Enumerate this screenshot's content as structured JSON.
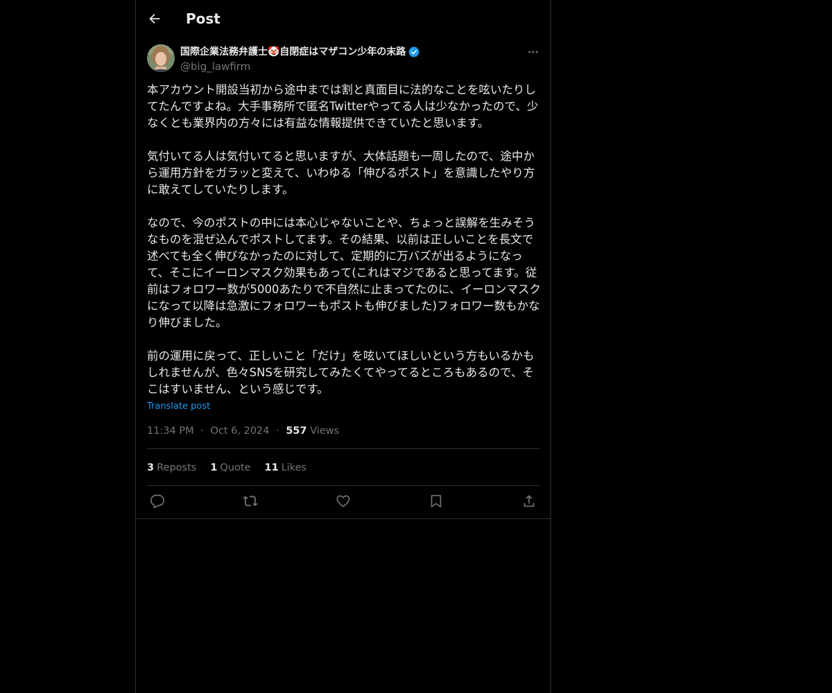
{
  "header": {
    "title": "Post",
    "back_icon": "arrow-left-icon"
  },
  "author": {
    "display_name": "国際企業法務弁護士🤡自閉症はマザコン少年の末路",
    "handle": "@big_lawfirm",
    "verified": true,
    "verified_color": "#1d9bf0",
    "avatar_icon": "user-avatar"
  },
  "post": {
    "text": "本アカウント開設当初から途中までは割と真面目に法的なことを呟いたりしてたんですよね。大手事務所で匿名Twitterやってる人は少なかったので、少なくとも業界内の方々には有益な情報提供できていたと思います。\n\n気付いてる人は気付いてると思いますが、大体話題も一周したので、途中から運用方針をガラッと変えて、いわゆる「伸びるポスト」を意識したやり方に敢えてしていたりします。\n\nなので、今のポストの中には本心じゃないことや、ちょっと誤解を生みそうなものを混ぜ込んでポストしてます。その結果、以前は正しいことを長文で述べても全く伸びなかったのに対して、定期的に万バズが出るようになって、そこにイーロンマスク効果もあって(これはマジであると思ってます。従前はフォロワー数が5000あたりで不自然に止まってたのに、イーロンマスクになって以降は急激にフォロワーもポストも伸びました)フォロワー数もかなり伸びました。\n\n前の運用に戻って、正しいこと「だけ」を呟いてほしいという方もいるかもしれませんが、色々SNSを研究してみたくてやってるところもあるので、そこはすいません、という感じです。",
    "translate_label": "Translate post",
    "time": "11:34 PM",
    "separator": "·",
    "date": "Oct 6, 2024",
    "views_count": "557",
    "views_label": "Views"
  },
  "stats": {
    "reposts_count": "3",
    "reposts_label": "Reposts",
    "quotes_count": "1",
    "quotes_label": "Quote",
    "likes_count": "11",
    "likes_label": "Likes"
  },
  "actions": [
    "reply-icon",
    "repost-icon",
    "like-icon",
    "bookmark-icon",
    "share-icon"
  ],
  "colors": {
    "background": "#000000",
    "text": "#e7e9ea",
    "muted": "#71767b",
    "link": "#1d9bf0",
    "border": "#2f3336"
  }
}
